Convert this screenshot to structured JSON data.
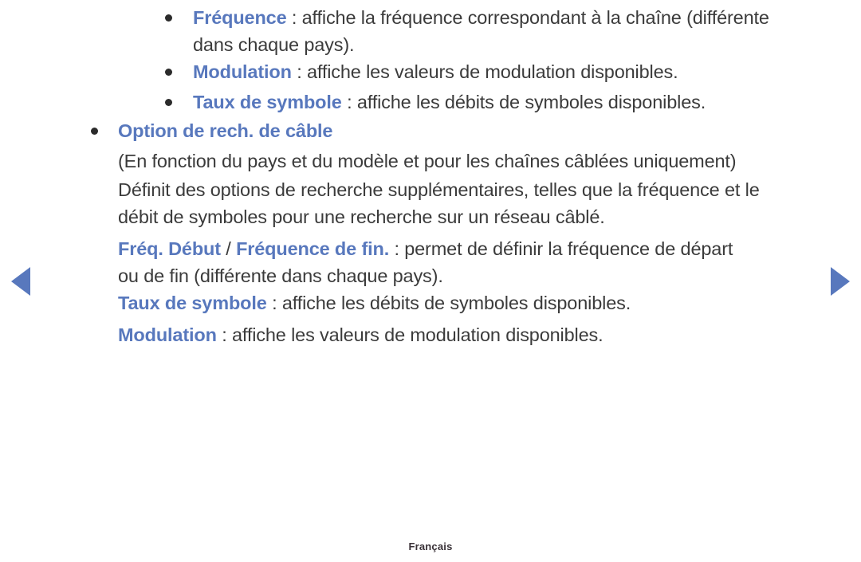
{
  "nav": {
    "prev_label": "◀",
    "next_label": "▶",
    "arrow_color": "#5878bd"
  },
  "footer": {
    "language": "Français"
  },
  "colors": {
    "keyword_blue": "#5878bd",
    "body_text": "#3b3b3b",
    "bullet": "#2b2b2b",
    "background": "#ffffff"
  },
  "content": {
    "blocks": [
      {
        "id": "frequence",
        "bullet": true,
        "indent": "sub",
        "lines": [
          {
            "keyword": "Fréquence",
            "rest": " : affiche la fréquence correspondant à la chaîne (différente"
          },
          {
            "keyword": "",
            "rest": "dans chaque pays)."
          }
        ]
      },
      {
        "id": "modulation-1",
        "bullet": true,
        "indent": "sub",
        "lines": [
          {
            "keyword": "Modulation",
            "rest": " : affiche les valeurs de modulation disponibles."
          }
        ]
      },
      {
        "id": "taux-de-symbole-1",
        "bullet": true,
        "indent": "sub",
        "lines": [
          {
            "keyword": "Taux de symbole",
            "rest": " : affiche les débits de symboles disponibles."
          }
        ]
      },
      {
        "id": "option-de-rech-de-cable",
        "bullet": true,
        "indent": "main",
        "lines": [
          {
            "keyword": "Option de rech. de câble",
            "rest": ""
          }
        ]
      },
      {
        "id": "note-pays-modele",
        "bullet": false,
        "indent": "body",
        "lines": [
          {
            "keyword": "",
            "rest": "(En fonction du pays et du modèle et pour les chaînes câblées uniquement)"
          }
        ]
      },
      {
        "id": "definit-options",
        "bullet": false,
        "indent": "body",
        "lines": [
          {
            "keyword": "",
            "rest": "Définit des options de recherche supplémentaires, telles que la fréquence et le"
          },
          {
            "keyword": "",
            "rest": "débit de symboles pour une recherche sur un réseau câblé."
          }
        ]
      },
      {
        "id": "freq-debut-fin",
        "bullet": false,
        "indent": "body",
        "lines": [
          {
            "keyword": "Fréq. Début",
            "separator": " / ",
            "keyword2": "Fréquence de fin.",
            "rest": " : permet de définir la fréquence de départ"
          },
          {
            "keyword": "",
            "rest": "ou de fin (différente dans chaque pays)."
          }
        ]
      },
      {
        "id": "taux-de-symbole-2",
        "bullet": false,
        "indent": "body",
        "lines": [
          {
            "keyword": "Taux de symbole",
            "rest": " : affiche les débits de symboles disponibles."
          }
        ]
      },
      {
        "id": "modulation-2",
        "bullet": false,
        "indent": "body",
        "lines": [
          {
            "keyword": "Modulation",
            "rest": " : affiche les valeurs de modulation disponibles."
          }
        ]
      }
    ]
  }
}
